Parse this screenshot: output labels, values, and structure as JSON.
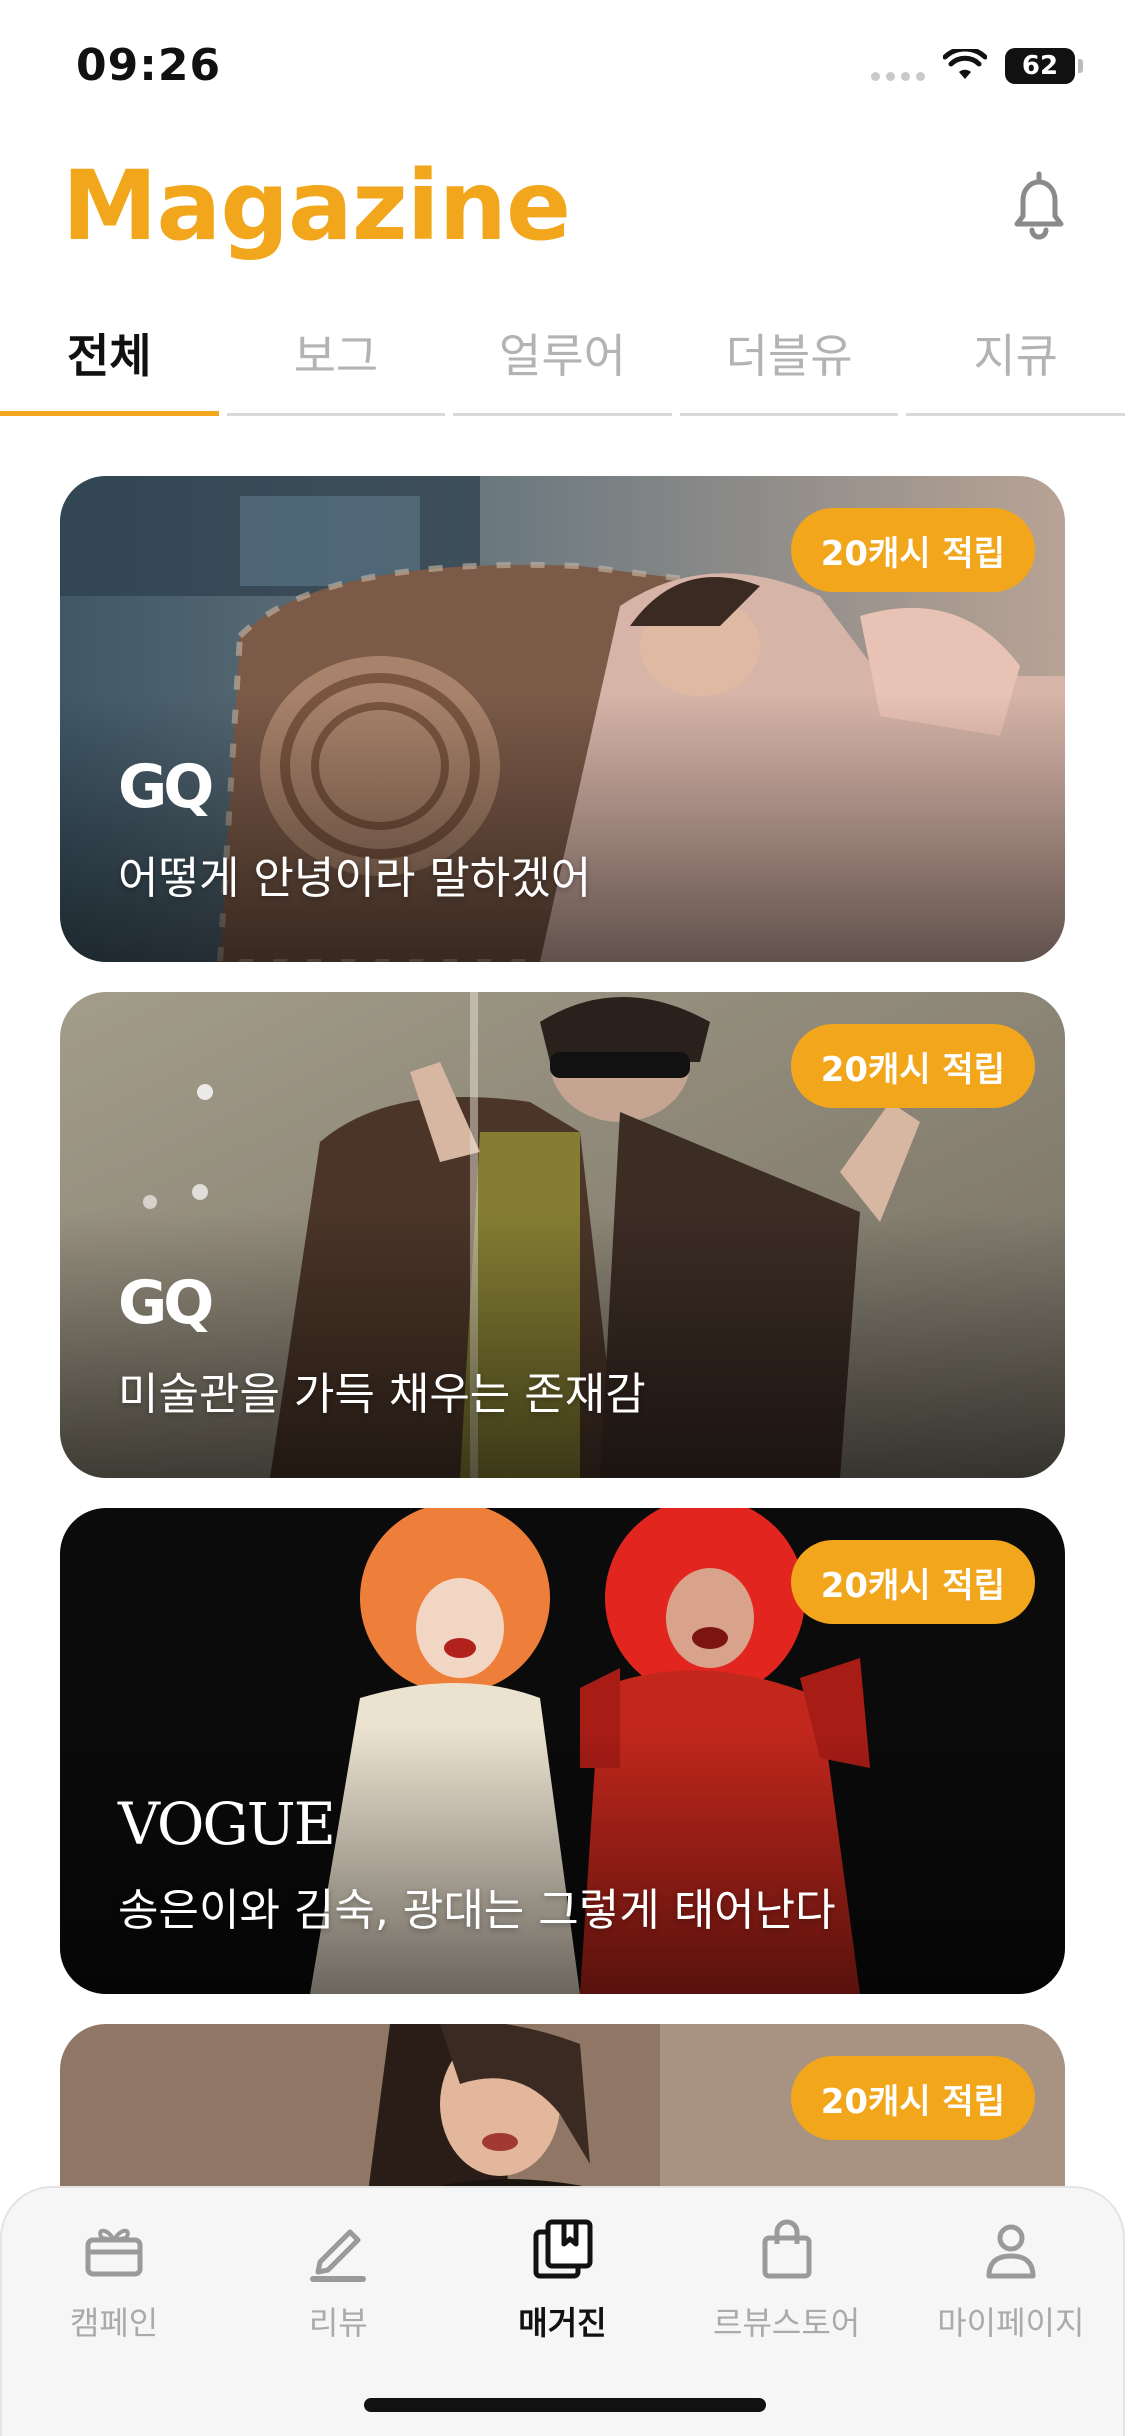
{
  "status_bar": {
    "time": "09:26",
    "battery": "62"
  },
  "header": {
    "title": "Magazine",
    "icon": "bell-icon"
  },
  "tabs": [
    {
      "label": "전체",
      "active": true
    },
    {
      "label": "보그",
      "active": false
    },
    {
      "label": "얼루어",
      "active": false
    },
    {
      "label": "더블유",
      "active": false
    },
    {
      "label": "지큐",
      "active": false
    }
  ],
  "cards": [
    {
      "badge": "20캐시 적립",
      "magazine": "GQ",
      "title": "어떻게 안녕이라 말하겠어"
    },
    {
      "badge": "20캐시 적립",
      "magazine": "GQ",
      "title": "미술관을 가득 채우는 존재감"
    },
    {
      "badge": "20캐시 적립",
      "magazine": "VOGUE",
      "title": "송은이와 김숙, 광대는 그렇게 태어난다"
    },
    {
      "badge": "20캐시 적립"
    }
  ],
  "bottom_nav": [
    {
      "label": "캠페인",
      "icon": "gift-icon",
      "active": false
    },
    {
      "label": "리뷰",
      "icon": "pencil-icon",
      "active": false
    },
    {
      "label": "매거진",
      "icon": "magazine-icon",
      "active": true
    },
    {
      "label": "르뷰스토어",
      "icon": "shopping-bag-icon",
      "active": false
    },
    {
      "label": "마이페이지",
      "icon": "person-icon",
      "active": false
    }
  ],
  "colors": {
    "accent": "#F2A61B",
    "active_text": "#111111",
    "inactive_text": "#B3B3B3"
  }
}
